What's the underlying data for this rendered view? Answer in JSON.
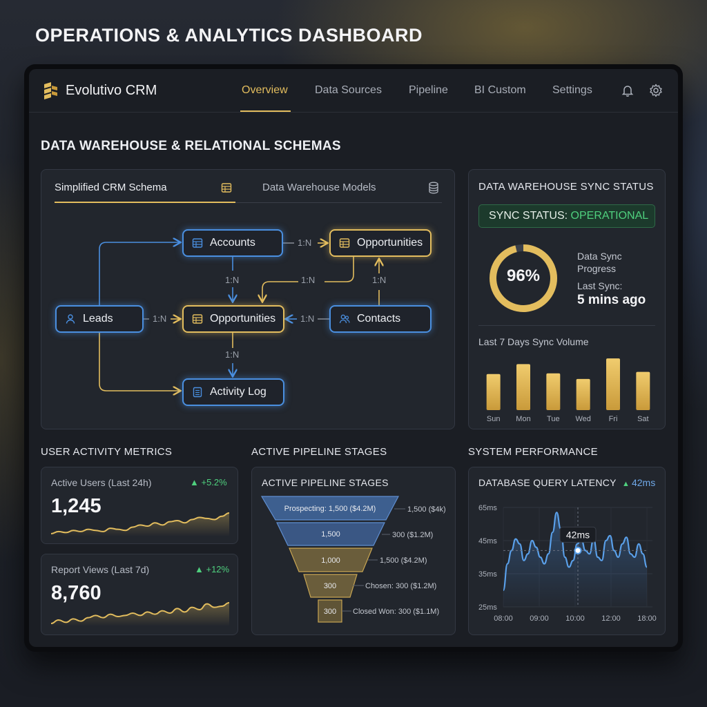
{
  "page": {
    "title": "OPERATIONS & ANALYTICS DASHBOARD"
  },
  "app": {
    "name": "Evolutivo CRM"
  },
  "nav": {
    "tabs": [
      {
        "label": "Overview",
        "active": true
      },
      {
        "label": "Data Sources",
        "active": false
      },
      {
        "label": "Pipeline",
        "active": false
      },
      {
        "label": "BI Custom",
        "active": false
      },
      {
        "label": "Settings",
        "active": false
      }
    ],
    "icons": [
      "bell-icon",
      "gear-icon"
    ]
  },
  "schema_section": {
    "title": "DATA WAREHOUSE & RELATIONAL SCHEMAS"
  },
  "schema": {
    "tabs": [
      {
        "label": "Simplified CRM Schema",
        "icon": "table-icon",
        "active": true
      },
      {
        "label": "Data Warehouse Models",
        "icon": "database-icon",
        "active": false
      }
    ],
    "nodes": {
      "accounts": "Accounts",
      "opportunities_top": "Opportunities",
      "leads": "Leads",
      "opportunities_mid": "Opportunities",
      "contacts": "Contacts",
      "activity_log": "Activity Log"
    },
    "relations": {
      "accounts_opps_top": "1:N",
      "accounts_opps_mid": "1:N",
      "opps_top_opps_mid": "1:N",
      "contacts_opps_top": "1:N",
      "leads_opps_mid": "1:N",
      "contacts_opps_mid": "1:N",
      "opps_mid_activity": "1:N"
    }
  },
  "sync": {
    "title": "DATA WAREHOUSE SYNC STATUS",
    "status_label": "SYNC STATUS: ",
    "status_value": "OPERATIONAL",
    "progress_percent": 96,
    "progress_text": "96%",
    "progress_label_1": "Data Sync",
    "progress_label_2": "Progress",
    "last_sync_label": "Last Sync:",
    "last_sync_value": "5 mins ago",
    "volume_title": "Last 7 Days Sync Volume",
    "colors": {
      "ok": "#4fd07e",
      "accent": "#e3bd5e"
    }
  },
  "sync_volume_chart": {
    "type": "bar",
    "categories": [
      "Sun",
      "Mon",
      "Tue",
      "Wed",
      "Fri",
      "Sat"
    ],
    "values": [
      51,
      65,
      52,
      44,
      73,
      54
    ],
    "ylim": [
      0,
      80
    ]
  },
  "user_activity": {
    "section_title": "USER ACTIVITY METRICS",
    "cards": [
      {
        "title": "Active Users (Last 24h)",
        "value": "1,245",
        "delta": "+5.2%",
        "trend": [
          5,
          7,
          6,
          8,
          7,
          9,
          8,
          7,
          10,
          9,
          8,
          11,
          13,
          12,
          15,
          13,
          16,
          17,
          15,
          18,
          20,
          19,
          18,
          21,
          24
        ]
      },
      {
        "title": "Report Views (Last 7d)",
        "value": "8,760",
        "delta": "+12%",
        "trend": [
          5,
          8,
          6,
          9,
          7,
          10,
          12,
          10,
          13,
          11,
          12,
          14,
          12,
          15,
          13,
          16,
          14,
          18,
          15,
          19,
          17,
          22,
          19,
          20,
          23
        ]
      }
    ]
  },
  "pipeline": {
    "section_title": "ACTIVE PIPELINE STAGES",
    "panel_title": "ACTIVE PIPELINE STAGES",
    "stages": [
      {
        "label": "Prospecting: 1,500 ($4.2M)",
        "side": "1,500 ($4k)"
      },
      {
        "label": "1,500",
        "side": "300 ($1.2M)"
      },
      {
        "label": "1,000",
        "side": "1,500 ($4.2M)"
      },
      {
        "label": "300",
        "side": "Chosen: 300 ($1.2M)"
      },
      {
        "label": "300",
        "side": "Closed Won: 300 ($1.1M)"
      }
    ]
  },
  "performance": {
    "section_title": "SYSTEM PERFORMANCE",
    "panel_title": "DATABASE QUERY LATENCY",
    "current": "42ms",
    "tooltip": "42ms"
  },
  "chart_data": {
    "type": "line",
    "title": "DATABASE QUERY LATENCY",
    "xlabel": "",
    "ylabel": "",
    "x_ticks": [
      "08:00",
      "09:00",
      "10:00",
      "12:00",
      "18:00"
    ],
    "y_ticks": [
      "65ms",
      "45ms",
      "35ms",
      "25ms"
    ],
    "series": [
      {
        "values": [
          30,
          38,
          42,
          46,
          44,
          39,
          41,
          45,
          43,
          40,
          38,
          41,
          50,
          62,
          52,
          40,
          37,
          39,
          44,
          46,
          42,
          41,
          46,
          40,
          39,
          45,
          48,
          42,
          40,
          44,
          47,
          41,
          40,
          44,
          41,
          37
        ]
      }
    ],
    "highlight": {
      "label": "42ms",
      "value": 42
    },
    "grid": true
  }
}
